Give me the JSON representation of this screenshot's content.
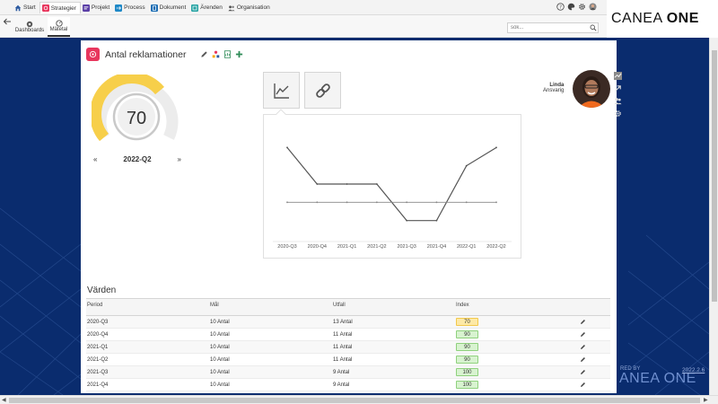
{
  "nav": {
    "items": [
      {
        "label": "Start",
        "icon": "home-icon",
        "color": "#2c5aa0"
      },
      {
        "label": "Strategier",
        "icon": "strategy-icon",
        "color": "#e8365d"
      },
      {
        "label": "Projekt",
        "icon": "project-icon",
        "color": "#5b3fa6"
      },
      {
        "label": "Process",
        "icon": "process-icon",
        "color": "#1e88c7"
      },
      {
        "label": "Dokument",
        "icon": "document-icon",
        "color": "#1e6fb5"
      },
      {
        "label": "Ärenden",
        "icon": "case-icon",
        "color": "#26a3a3"
      },
      {
        "label": "Organisation",
        "icon": "organisation-icon",
        "color": "#555555"
      }
    ]
  },
  "subnav": {
    "tabs": [
      {
        "label": "Dashboards"
      },
      {
        "label": "Mätetal"
      }
    ]
  },
  "search": {
    "placeholder": "sök..."
  },
  "brand": {
    "name": "CANEA",
    "suffix": "ONE"
  },
  "measure": {
    "title": "Antal reklamationer",
    "gauge_value": "70",
    "period": "2022-Q2",
    "prev": "«",
    "next": "»",
    "owner_name": "Linda",
    "owner_role": "Ansvarig"
  },
  "chart_data": {
    "type": "line",
    "categories": [
      "2020-Q3",
      "2020-Q4",
      "2021-Q1",
      "2021-Q2",
      "2021-Q3",
      "2021-Q4",
      "2022-Q1",
      "2022-Q2"
    ],
    "series": [
      {
        "values": [
          13,
          11,
          11,
          11,
          9,
          9,
          12,
          13
        ],
        "color": "#555555"
      },
      {
        "values": [
          10,
          10,
          10,
          10,
          10,
          10,
          10,
          10
        ],
        "color": "#888888"
      }
    ],
    "ylim": [
      8,
      14
    ]
  },
  "table": {
    "section_title": "Värden",
    "headers": {
      "period": "Period",
      "goal": "Mål",
      "outcome": "Utfall",
      "index": "Index"
    },
    "rows": [
      {
        "period": "2020-Q3",
        "goal": "10 Antal",
        "outcome": "13 Antal",
        "index": "70",
        "status": "yellow"
      },
      {
        "period": "2020-Q4",
        "goal": "10 Antal",
        "outcome": "11 Antal",
        "index": "90",
        "status": "green"
      },
      {
        "period": "2021-Q1",
        "goal": "10 Antal",
        "outcome": "11 Antal",
        "index": "90",
        "status": "green"
      },
      {
        "period": "2021-Q2",
        "goal": "10 Antal",
        "outcome": "11 Antal",
        "index": "90",
        "status": "green"
      },
      {
        "period": "2021-Q3",
        "goal": "10 Antal",
        "outcome": "9 Antal",
        "index": "100",
        "status": "green"
      },
      {
        "period": "2021-Q4",
        "goal": "10 Antal",
        "outcome": "9 Antal",
        "index": "100",
        "status": "green"
      }
    ]
  },
  "footer": {
    "powered": "RED BY",
    "one": "ANEA ONE",
    "version": "2022.2.6"
  },
  "colors": {
    "accent": "#e8365d",
    "background": "#0a2c6e",
    "gauge": "#f7cf4a"
  }
}
